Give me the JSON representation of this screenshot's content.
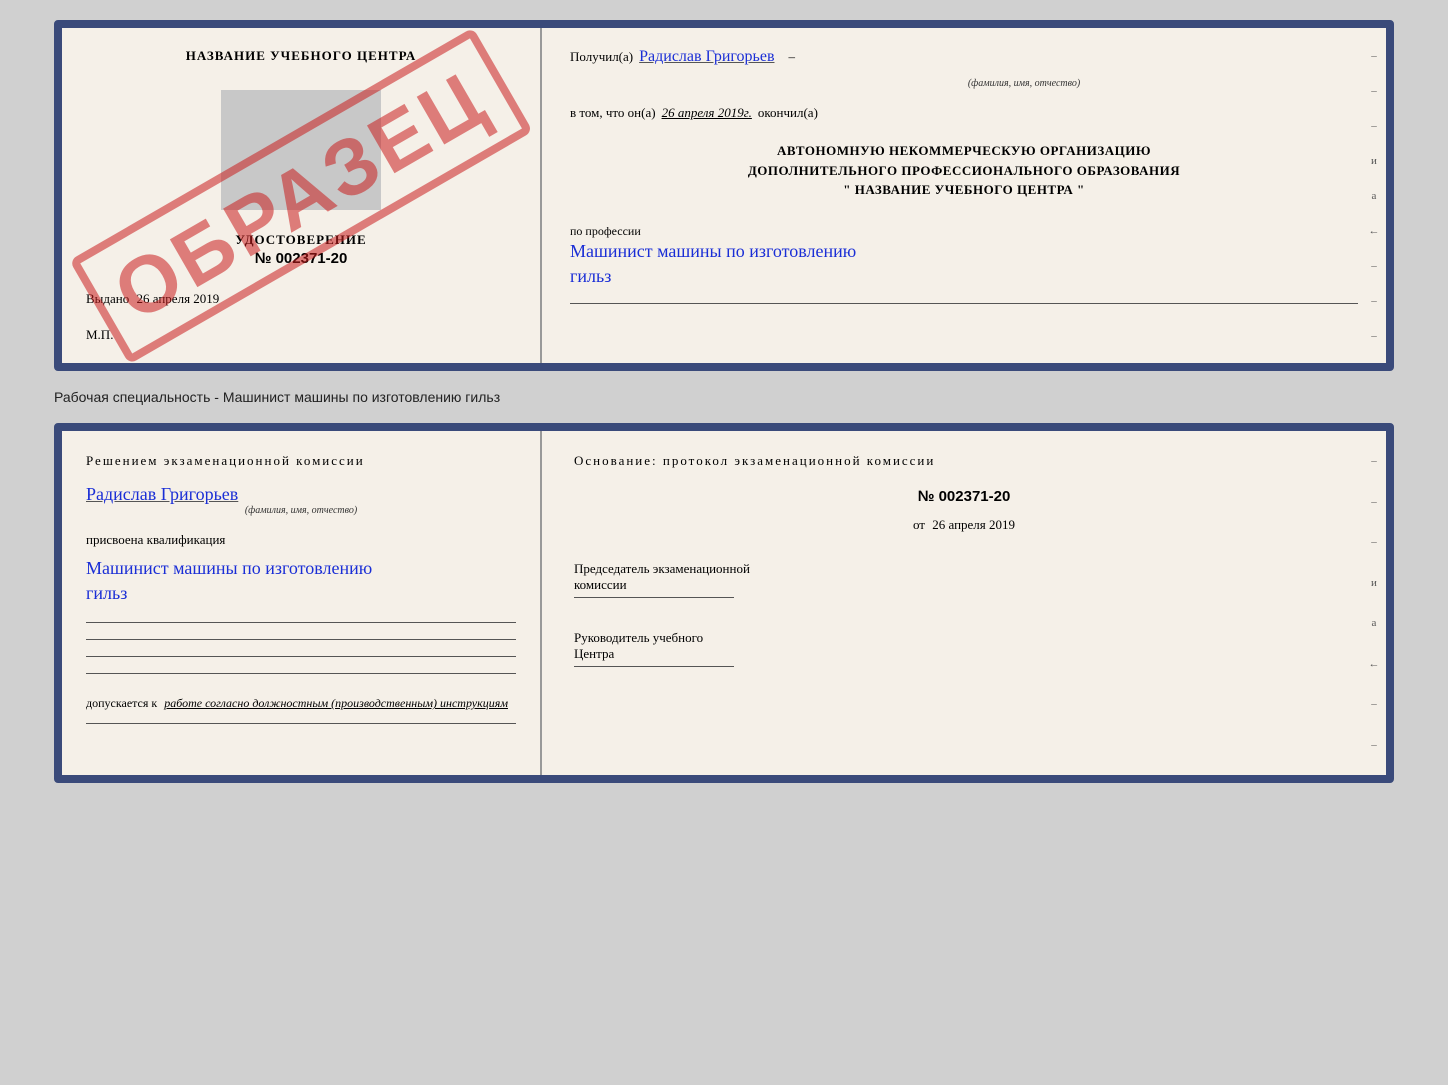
{
  "top_document": {
    "left": {
      "title": "НАЗВАНИЕ УЧЕБНОГО ЦЕНТРА",
      "watermark": "ОБРАЗЕЦ",
      "udostoverenie": "УДОСТОВЕРЕНИЕ",
      "number": "№ 002371-20",
      "vydano_label": "Выдано",
      "vydano_date": "26 апреля 2019",
      "mp": "М.П."
    },
    "right": {
      "poluchil_label": "Получил(а)",
      "poluchil_name": "Радислав Григорьев",
      "fio_hint": "(фамилия, имя, отчество)",
      "vtom_label": "в том, что он(а)",
      "vtom_date": "26 апреля 2019г.",
      "okonchil": "окончил(а)",
      "org_line1": "АВТОНОМНУЮ НЕКОММЕРЧЕСКУЮ ОРГАНИЗАЦИЮ",
      "org_line2": "ДОПОЛНИТЕЛЬНОГО ПРОФЕССИОНАЛЬНОГО ОБРАЗОВАНИЯ",
      "org_line3": "\"   НАЗВАНИЕ УЧЕБНОГО ЦЕНТРА   \"",
      "po_professii": "по профессии",
      "profession1": "Машинист машины по изготовлению",
      "profession2": "гильз",
      "side_i": "и",
      "side_a": "а",
      "side_arrow": "←",
      "dashes": [
        "–",
        "–",
        "–",
        "–",
        "–",
        "–",
        "–",
        "–",
        "–"
      ]
    }
  },
  "caption": "Рабочая специальность - Машинист машины по изготовлению гильз",
  "bottom_document": {
    "left": {
      "resheniyem": "Решением  экзаменационной  комиссии",
      "name": "Радислав Григорьев",
      "fio_hint": "(фамилия, имя, отчество)",
      "prisvoyena": "присвоена квалификация",
      "kvalif1": "Машинист машины по изготовлению",
      "kvalif2": "гильз",
      "dopuskaetsya": "допускается к",
      "dopusk_text": "работе согласно должностным (производственным) инструкциям"
    },
    "right": {
      "osnovanie": "Основание: протокол экзаменационной  комиссии",
      "number": "№  002371-20",
      "ot_label": "от",
      "ot_date": "26 апреля 2019",
      "predsedatel_line1": "Председатель экзаменационной",
      "predsedatel_line2": "комиссии",
      "rukovoditel_line1": "Руководитель учебного",
      "rukovoditel_line2": "Центра",
      "side_i": "и",
      "side_a": "а",
      "side_arrow": "←",
      "dashes": [
        "–",
        "–",
        "–",
        "–",
        "–",
        "–",
        "–",
        "–"
      ]
    }
  }
}
